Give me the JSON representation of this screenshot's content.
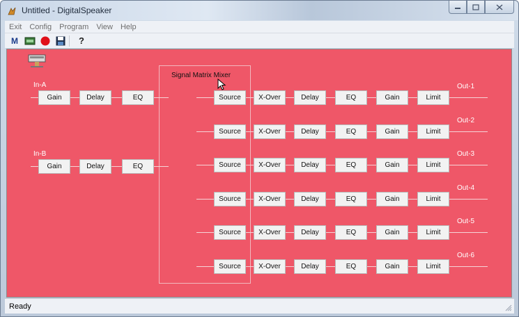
{
  "window": {
    "title": "Untitled - DigitalSpeaker"
  },
  "menu": [
    "Exit",
    "Config",
    "Program",
    "View",
    "Help"
  ],
  "toolbar": {
    "m_label": "M",
    "help_label": "?"
  },
  "status": "Ready",
  "mixer": {
    "title": "Signal Matrix Mixer"
  },
  "inputs": [
    {
      "label": "In-A",
      "blocks": [
        "Gain",
        "Delay",
        "EQ"
      ]
    },
    {
      "label": "In-B",
      "blocks": [
        "Gain",
        "Delay",
        "EQ"
      ]
    }
  ],
  "outputs": [
    {
      "label": "Out-1",
      "blocks": [
        "Source",
        "X-Over",
        "Delay",
        "EQ",
        "Gain",
        "Limit"
      ]
    },
    {
      "label": "Out-2",
      "blocks": [
        "Source",
        "X-Over",
        "Delay",
        "EQ",
        "Gain",
        "Limit"
      ]
    },
    {
      "label": "Out-3",
      "blocks": [
        "Source",
        "X-Over",
        "Delay",
        "EQ",
        "Gain",
        "Limit"
      ]
    },
    {
      "label": "Out-4",
      "blocks": [
        "Source",
        "X-Over",
        "Delay",
        "EQ",
        "Gain",
        "Limit"
      ]
    },
    {
      "label": "Out-5",
      "blocks": [
        "Source",
        "X-Over",
        "Delay",
        "EQ",
        "Gain",
        "Limit"
      ]
    },
    {
      "label": "Out-6",
      "blocks": [
        "Source",
        "X-Over",
        "Delay",
        "EQ",
        "Gain",
        "Limit"
      ]
    }
  ],
  "colors": {
    "canvas": "#ef5768",
    "record": "#e0101a"
  }
}
